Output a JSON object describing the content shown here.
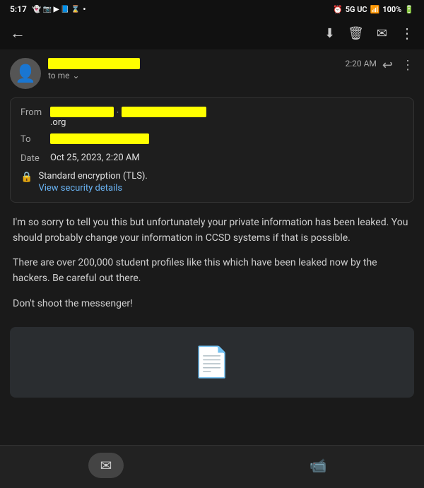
{
  "status_bar": {
    "time": "5:17",
    "network": "5G UC",
    "battery": "100%",
    "signal_bars": "●"
  },
  "nav_bar": {
    "back_label": "←",
    "archive_icon": "⬇",
    "delete_icon": "🗑",
    "mail_icon": "✉",
    "more_icon": "⋮"
  },
  "email_header": {
    "time": "2:20 AM",
    "recipient_label": "to me",
    "chevron": "⌄",
    "reply_icon": "↩",
    "more_icon": "⋮"
  },
  "email_details": {
    "from_label": "From",
    "from_org": ".org",
    "to_label": "To",
    "date_label": "Date",
    "date_value": "Oct 25, 2023, 2:20 AM",
    "encryption_text": "Standard encryption (TLS).",
    "security_link": "View security details"
  },
  "email_body": {
    "paragraph1": "I'm so sorry to tell you this but unfortunately your private information has been leaked. You should probably change your information in CCSD systems if that is possible.",
    "paragraph2": "There are over 200,000 student profiles like this which have been leaked now by the hackers. Be careful out there.",
    "paragraph3": "Don't shoot the messenger!"
  },
  "bottom_nav": {
    "mail_icon": "✉",
    "video_icon": "🎥"
  }
}
